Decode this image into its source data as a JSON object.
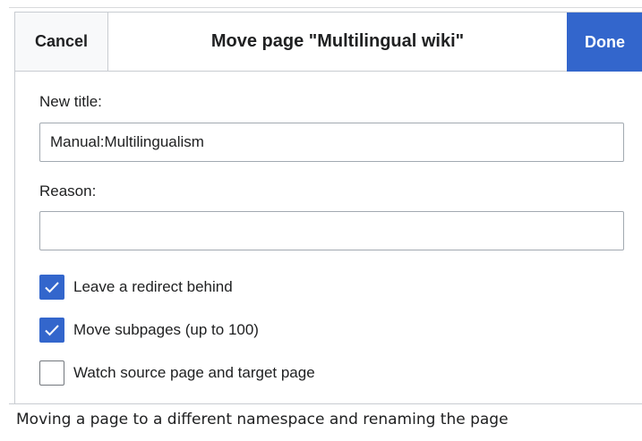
{
  "dialog": {
    "title": "Move page \"Multilingual wiki\"",
    "cancel_label": "Cancel",
    "done_label": "Done"
  },
  "form": {
    "new_title_label": "New title:",
    "new_title_value": "Manual:Multilingualism",
    "reason_label": "Reason:",
    "reason_value": "",
    "checkboxes": [
      {
        "label": "Leave a redirect behind",
        "checked": true
      },
      {
        "label": "Move subpages (up to 100)",
        "checked": true
      },
      {
        "label": "Watch source page and target page",
        "checked": false
      }
    ]
  },
  "caption": "Moving a page to a different namespace and renaming the page",
  "icons": {
    "checkbox_checked": "checkmark-icon"
  },
  "colors": {
    "accent": "#3366cc",
    "border": "#c8ccd1",
    "input_border": "#a2a9b1",
    "text": "#202122"
  }
}
